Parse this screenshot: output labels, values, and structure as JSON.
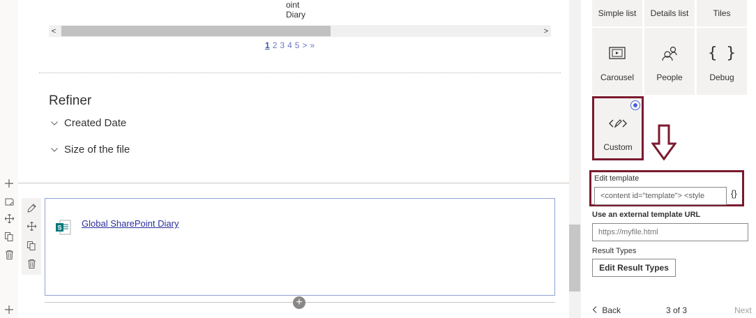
{
  "main": {
    "cut_text_line1": "oint",
    "cut_text_line2": "Diary",
    "scroll_left": "<",
    "scroll_right": ">",
    "pager": {
      "pages": [
        "1",
        "2",
        "3",
        "4",
        "5"
      ],
      "next": ">",
      "last": "»"
    },
    "refiner": {
      "title": "Refiner",
      "items": [
        "Created Date",
        "Size of the file"
      ]
    },
    "result": {
      "link_text": "Global SharePoint Diary"
    },
    "add_button": "+"
  },
  "pane": {
    "layouts_top": [
      "Simple list",
      "Details list",
      "Tiles"
    ],
    "layouts": [
      {
        "label": "Carousel",
        "icon": "carousel-icon"
      },
      {
        "label": "People",
        "icon": "people-icon"
      },
      {
        "label": "Debug",
        "icon": "braces-icon"
      }
    ],
    "custom_label": "Custom",
    "edit_template": {
      "label": "Edit template",
      "value": "<content id=\"template\">    <style",
      "brace": "{}"
    },
    "external_template": {
      "label": "Use an external template URL",
      "placeholder": "https://myfile.html"
    },
    "result_types": {
      "label": "Result Types",
      "button": "Edit Result Types"
    },
    "footer": {
      "back": "Back",
      "page_count": "3 of 3",
      "next": "Next"
    }
  },
  "colors": {
    "highlight_border": "#7a1a2e",
    "link": "#2b2f9e",
    "pager": "#6b77c9",
    "sharepoint_green": "#03787c"
  }
}
